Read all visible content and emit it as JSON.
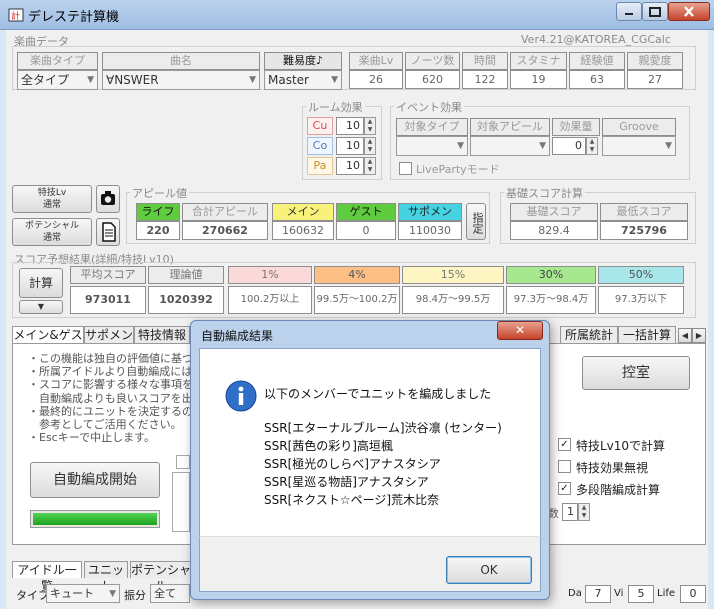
{
  "window": {
    "title": "デレステ計算機",
    "version": "Ver4.21@KATOREA_CGCalc"
  },
  "song": {
    "section": "楽曲データ",
    "type_label": "楽曲タイプ",
    "type_value": "全タイプ",
    "name_label": "曲名",
    "name_value": "∀NSWER",
    "diff_label": "難易度♪",
    "diff_value": "Master",
    "stats_labels": [
      "楽曲Lv",
      "ノーツ数",
      "時間",
      "スタミナ",
      "経験値",
      "親愛度"
    ],
    "stats_values": [
      "26",
      "620",
      "122",
      "19",
      "63",
      "27"
    ]
  },
  "room": {
    "title": "ルーム効果",
    "rows": [
      {
        "label": "Cu",
        "value": "10"
      },
      {
        "label": "Co",
        "value": "10"
      },
      {
        "label": "Pa",
        "value": "10"
      }
    ]
  },
  "event": {
    "title": "イベント効果",
    "headers": [
      "対象タイプ",
      "対象アピール",
      "効果量",
      "Groove"
    ],
    "amount": "0",
    "liveparty": "LivePartyモード"
  },
  "side": {
    "skill_btn": "特技Lv\n通常",
    "potential_btn": "ポテンシャル\n通常"
  },
  "appeal": {
    "title": "アピール値",
    "headers": [
      "ライフ",
      "合計アピール",
      "メイン",
      "ゲスト",
      "サポメン"
    ],
    "values": [
      "220",
      "270662",
      "160632",
      "0",
      "110030"
    ],
    "assign": "指定"
  },
  "base": {
    "title": "基礎スコア計算",
    "headers": [
      "基礎スコア",
      "最低スコア"
    ],
    "values": [
      "829.4",
      "725796"
    ]
  },
  "predict": {
    "title": "スコア予想結果(詳細/特技Lv10)",
    "calc": "計算",
    "headers": [
      "平均スコア",
      "理論値"
    ],
    "values": [
      "973011",
      "1020392"
    ],
    "pct_headers": [
      "1%",
      "4%",
      "15%",
      "30%",
      "50%"
    ],
    "pct_values": [
      "100.2万以上",
      "99.5万〜100.2万",
      "98.4万〜99.5万",
      "97.3万〜98.4万",
      "97.3万以下"
    ]
  },
  "tabs": {
    "items": [
      "メイン&ゲスト",
      "サポメン",
      "特技情報",
      "所属統計",
      "一括計算"
    ]
  },
  "auto": {
    "notes": [
      "・この機能は独自の評価値に基づ",
      "・所属アイドルより自動編成には",
      "・スコアに影響する様々な事項を考",
      "　自動編成よりも良いスコアを出せ",
      "・最終的にユニットを決定するのは",
      "　参考としてご活用ください。",
      "・Escキーで中止します。"
    ],
    "start": "自動編成開始",
    "room_btn": "控室",
    "opts": [
      "特技Lv10で計算",
      "特技効果無視",
      "多段階編成計算"
    ],
    "num": "1",
    "num_label": "数"
  },
  "bottom": {
    "tabs": [
      "アイドル一覧",
      "ユニット",
      "ポテンシャル"
    ],
    "type_label": "タイプ",
    "type_value": "キュート",
    "split_label": "振分",
    "split_value": "全て",
    "da_label": "Da",
    "da": "7",
    "vi_label": "Vi",
    "vi": "5",
    "life_label": "Life",
    "life": "0"
  },
  "dialog": {
    "title": "自動編成結果",
    "message": "以下のメンバーでユニットを編成しました",
    "members": [
      "SSR[エターナルブルーム]渋谷凛 (センター)",
      "SSR[茜色の彩り]高垣楓",
      "SSR[極光のしらべ]アナスタシア",
      "SSR[星巡る物語]アナスタシア",
      "SSR[ネクスト☆ページ]荒木比奈"
    ],
    "ok": "OK",
    "close": "✕"
  }
}
